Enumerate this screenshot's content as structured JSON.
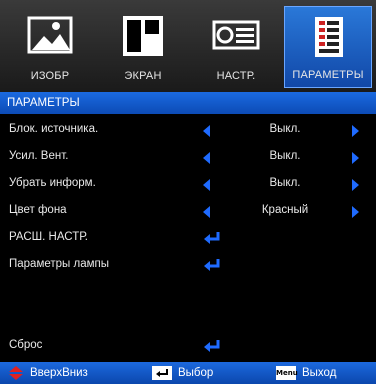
{
  "tabs": [
    {
      "label": "ИЗОБР",
      "icon": "picture-icon",
      "active": false
    },
    {
      "label": "ЭКРАН",
      "icon": "screen-icon",
      "active": false
    },
    {
      "label": "НАСТР.",
      "icon": "projector-settings-icon",
      "active": false
    },
    {
      "label": "ПАРАМЕТРЫ",
      "icon": "options-list-icon",
      "active": true
    }
  ],
  "section_title": "ПАРАМЕТРЫ",
  "rows": [
    {
      "label": "Блок. источника.",
      "value": "Выкл."
    },
    {
      "label": "Усил. Вент.",
      "value": "Выкл."
    },
    {
      "label": "Убрать информ.",
      "value": "Выкл."
    },
    {
      "label": "Цвет фона",
      "value": "Красный"
    },
    {
      "label": "РАСШ. НАСТР."
    },
    {
      "label": "Параметры лампы"
    },
    {
      "label": "Сброс"
    }
  ],
  "footer": {
    "nav_label": "ВверхВниз",
    "select_label": "Выбор",
    "menu_badge": "Menu",
    "exit_label": "Выход"
  },
  "colors": {
    "accent": "#1b6ae0",
    "arrow": "#1f6bff",
    "background": "#000000"
  }
}
